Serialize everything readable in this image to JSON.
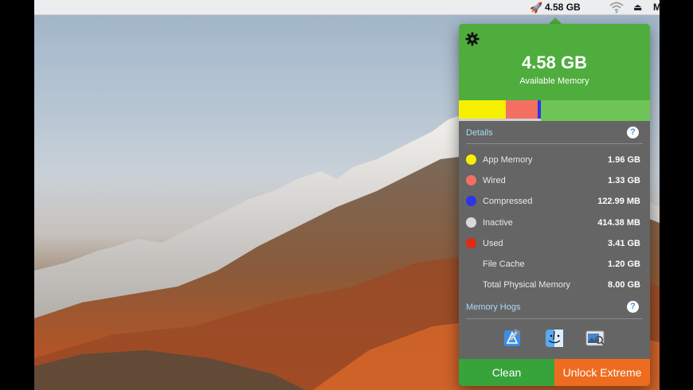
{
  "menubar": {
    "rocket_icon": "rocket-icon",
    "memory_text": "4.58 GB",
    "wifi_icon": "wifi-icon",
    "eject_glyph": "⏏",
    "user_initial": "M"
  },
  "popover": {
    "gear_icon": "gear-icon",
    "available_value": "4.58 GB",
    "available_label": "Available Memory",
    "usage_bar": [
      {
        "name": "App Memory",
        "fraction": 0.245,
        "color": "#f7f001"
      },
      {
        "name": "Wired",
        "fraction": 0.166,
        "color": "#f26f61"
      },
      {
        "name": "Compressed",
        "fraction": 0.015,
        "color": "#2a36e8"
      }
    ],
    "details": {
      "title": "Details",
      "help": "?",
      "rows": [
        {
          "label": "App Memory",
          "value": "1.96 GB",
          "color": "#f7f001"
        },
        {
          "label": "Wired",
          "value": "1.33 GB",
          "color": "#f26f61"
        },
        {
          "label": "Compressed",
          "value": "122.99 MB",
          "color": "#2a36e8"
        },
        {
          "label": "Inactive",
          "value": "414.38 MB",
          "color": "#d9d9d9"
        },
        {
          "label": "Used",
          "value": "3.41 GB",
          "color": "#e02a10"
        },
        {
          "label": "File Cache",
          "value": "1.20 GB",
          "color": ""
        },
        {
          "label": "Total Physical Memory",
          "value": "8.00 GB",
          "color": ""
        }
      ]
    },
    "hogs": {
      "title": "Memory Hogs",
      "help": "?",
      "apps": [
        "xcode-icon",
        "finder-icon",
        "preview-icon"
      ]
    },
    "buttons": {
      "clean": "Clean",
      "unlock": "Unlock Extreme"
    },
    "colors": {
      "header_green": "#4fad3e",
      "clean_green": "#37a33b",
      "unlock_orange": "#ee6c1f",
      "panel_gray": "#656565"
    }
  }
}
